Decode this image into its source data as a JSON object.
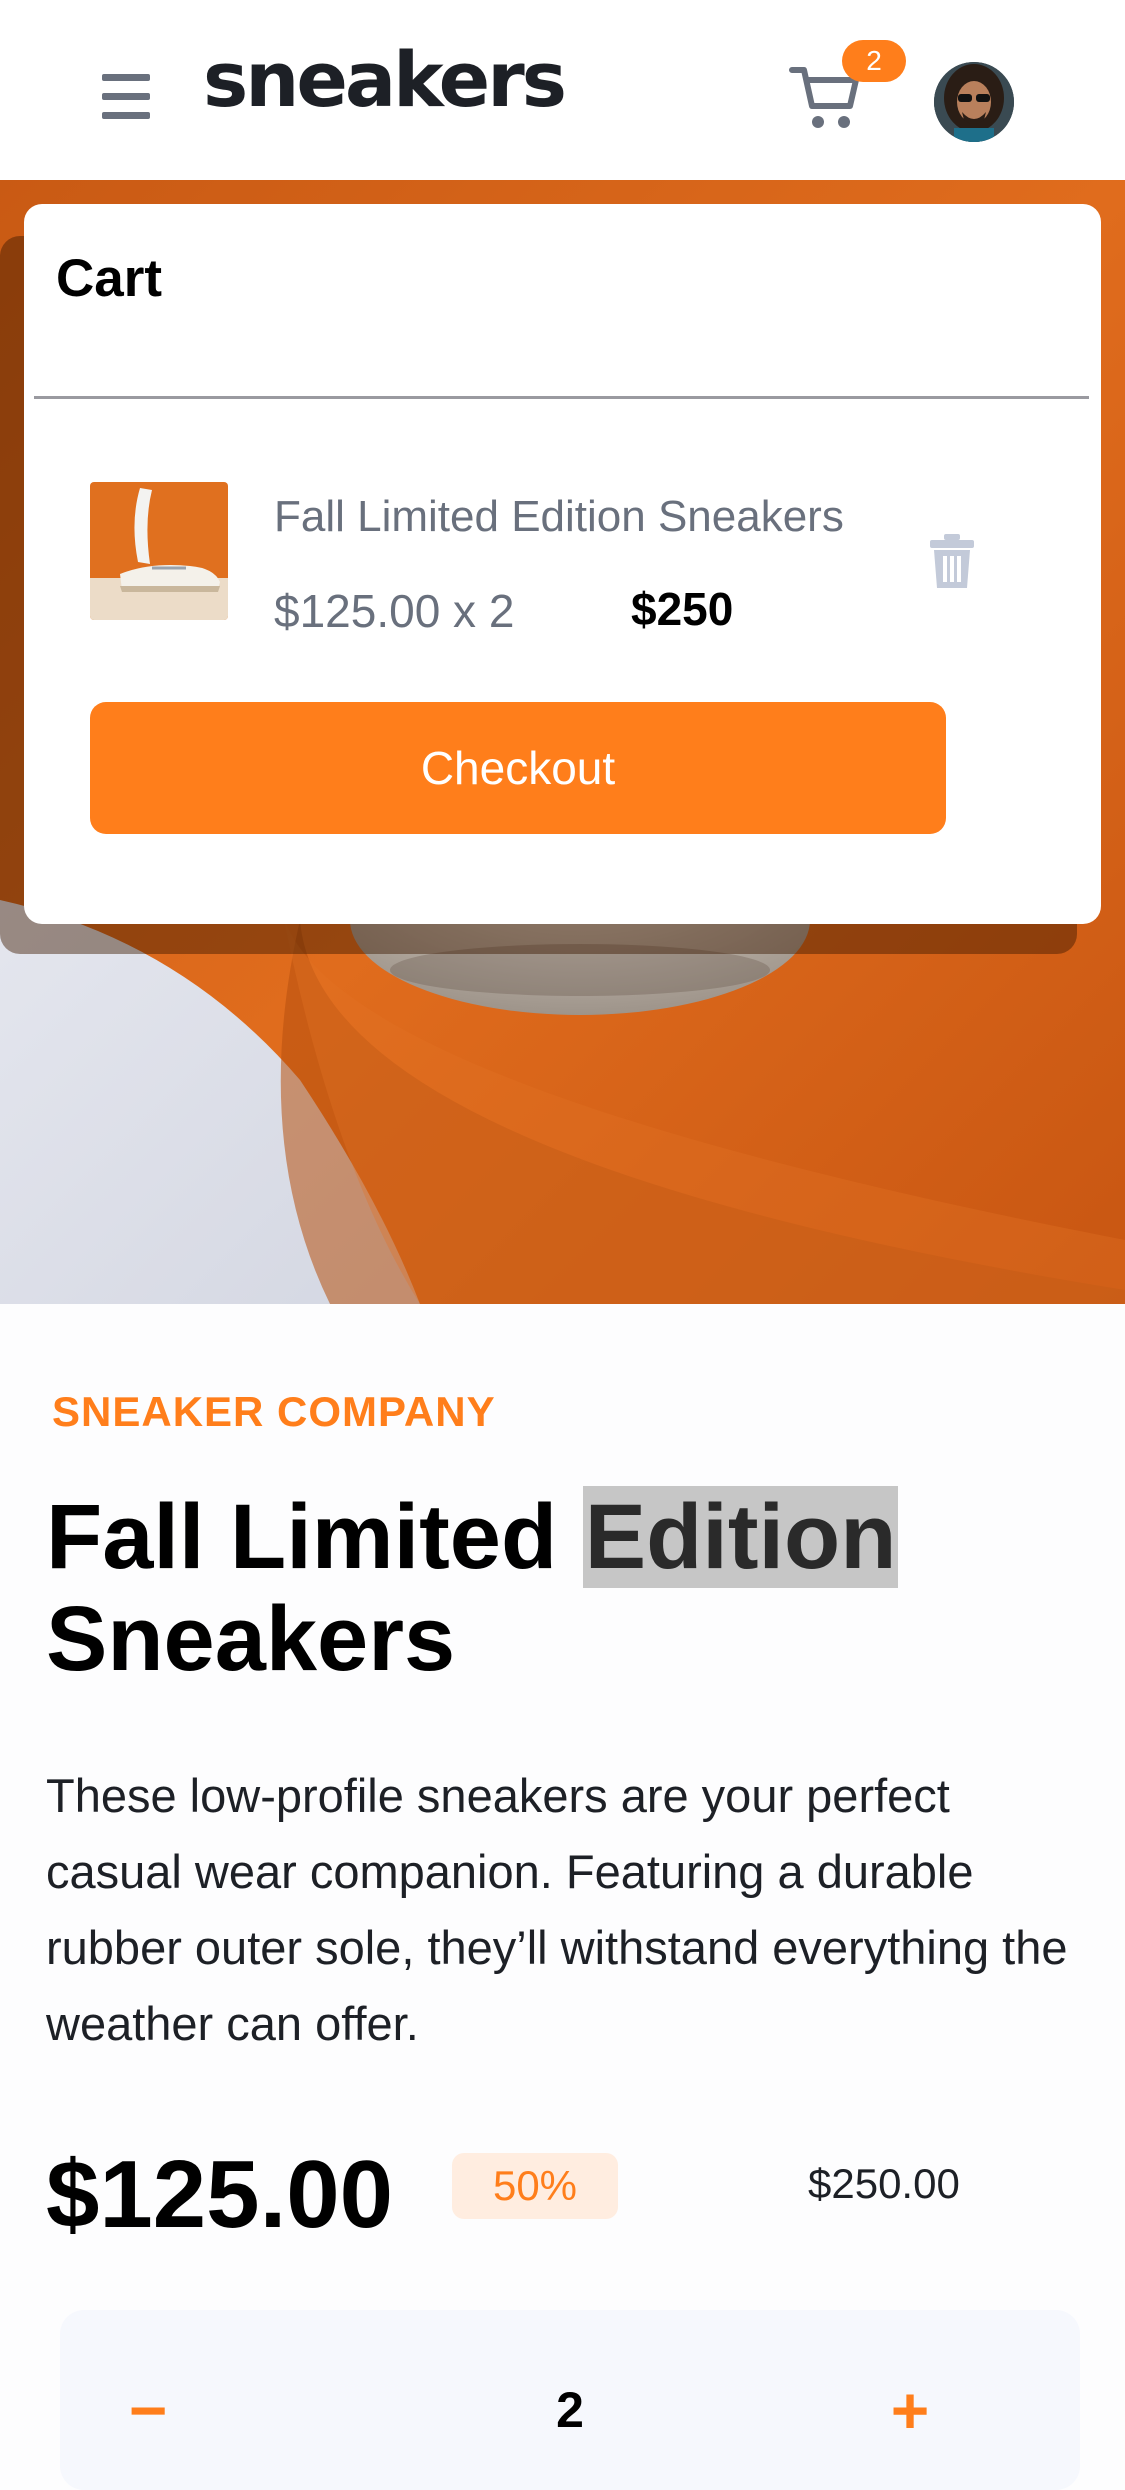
{
  "header": {
    "logo": "sneakers",
    "cart_count": "2",
    "icons": {
      "menu": "hamburger-menu-icon",
      "cart": "cart-icon",
      "avatar": "user-avatar"
    }
  },
  "cart": {
    "title": "Cart",
    "items": [
      {
        "name": "Fall Limited Edition Sneakers",
        "unit_price_qty": "$125.00 x 2",
        "total": "$250",
        "thumbnail": "sneaker-thumbnail",
        "delete_icon": "trash-icon"
      }
    ],
    "checkout_label": "Checkout"
  },
  "product": {
    "company": "SNEAKER COMPANY",
    "title_part1": "Fall Limited ",
    "title_highlight": "Edition",
    "title_part2": "Sneakers",
    "description": "These low-profile sneakers are your perfect casual wear companion. Featuring a durable rubber outer sole, they’ll withstand everything the weather can offer.",
    "price": "$125.00",
    "discount": "50%",
    "original_price": "$250.00"
  },
  "quantity": {
    "minus_label": "−",
    "value": "2",
    "plus_label": "+"
  },
  "colors": {
    "accent": "#ff7e1b",
    "accent_pale": "#ffede0",
    "text_dark": "#1d2026",
    "text_gray": "#69707d",
    "stepper_bg": "#f6f8fd"
  }
}
